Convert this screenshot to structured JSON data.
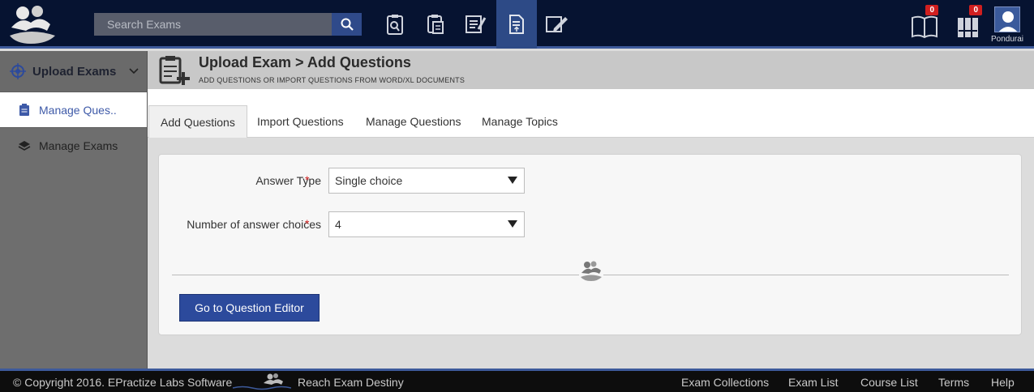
{
  "search": {
    "placeholder": "Search Exams"
  },
  "topnav": {
    "icons": [
      "clipboard-search-icon",
      "clipboard-list-icon",
      "checklist-icon",
      "document-upload-icon",
      "edit-pen-icon"
    ],
    "active": "document-upload-icon"
  },
  "tools": {
    "library_badge": "0",
    "collections_badge": "0",
    "user_name": "Pondurai"
  },
  "sidebar": {
    "header": "Upload Exams",
    "items": [
      {
        "label": "Manage Ques..",
        "icon": "clipboard-icon",
        "active": true
      },
      {
        "label": "Manage Exams",
        "icon": "stack-icon",
        "active": false
      }
    ]
  },
  "page": {
    "title": "Upload Exam > Add Questions",
    "subtitle": "ADD QUESTIONS OR IMPORT QUESTIONS FROM WORD/XL DOCUMENTS"
  },
  "tabs": [
    {
      "label": "Add Questions",
      "active": true
    },
    {
      "label": "Import Questions",
      "active": false
    },
    {
      "label": "Manage Questions",
      "active": false
    },
    {
      "label": "Manage Topics",
      "active": false
    }
  ],
  "form": {
    "answer_type_label": "Answer Type",
    "answer_type_value": "Single choice",
    "choices_label": "Number of answer choices",
    "choices_value": "4",
    "required_mark": "*",
    "submit_label": "Go to Question Editor"
  },
  "footer": {
    "copyright": "© Copyright 2016. EPractize Labs Software",
    "tagline": "Reach Exam Destiny",
    "links": [
      "Exam Collections",
      "Exam List",
      "Course List",
      "Terms",
      "Help"
    ]
  },
  "colors": {
    "topbar": "#061331",
    "accent": "#2c4a9c",
    "active_nav": "#2d4a86",
    "badge": "#d01f1f",
    "required": "#d01f1f"
  }
}
